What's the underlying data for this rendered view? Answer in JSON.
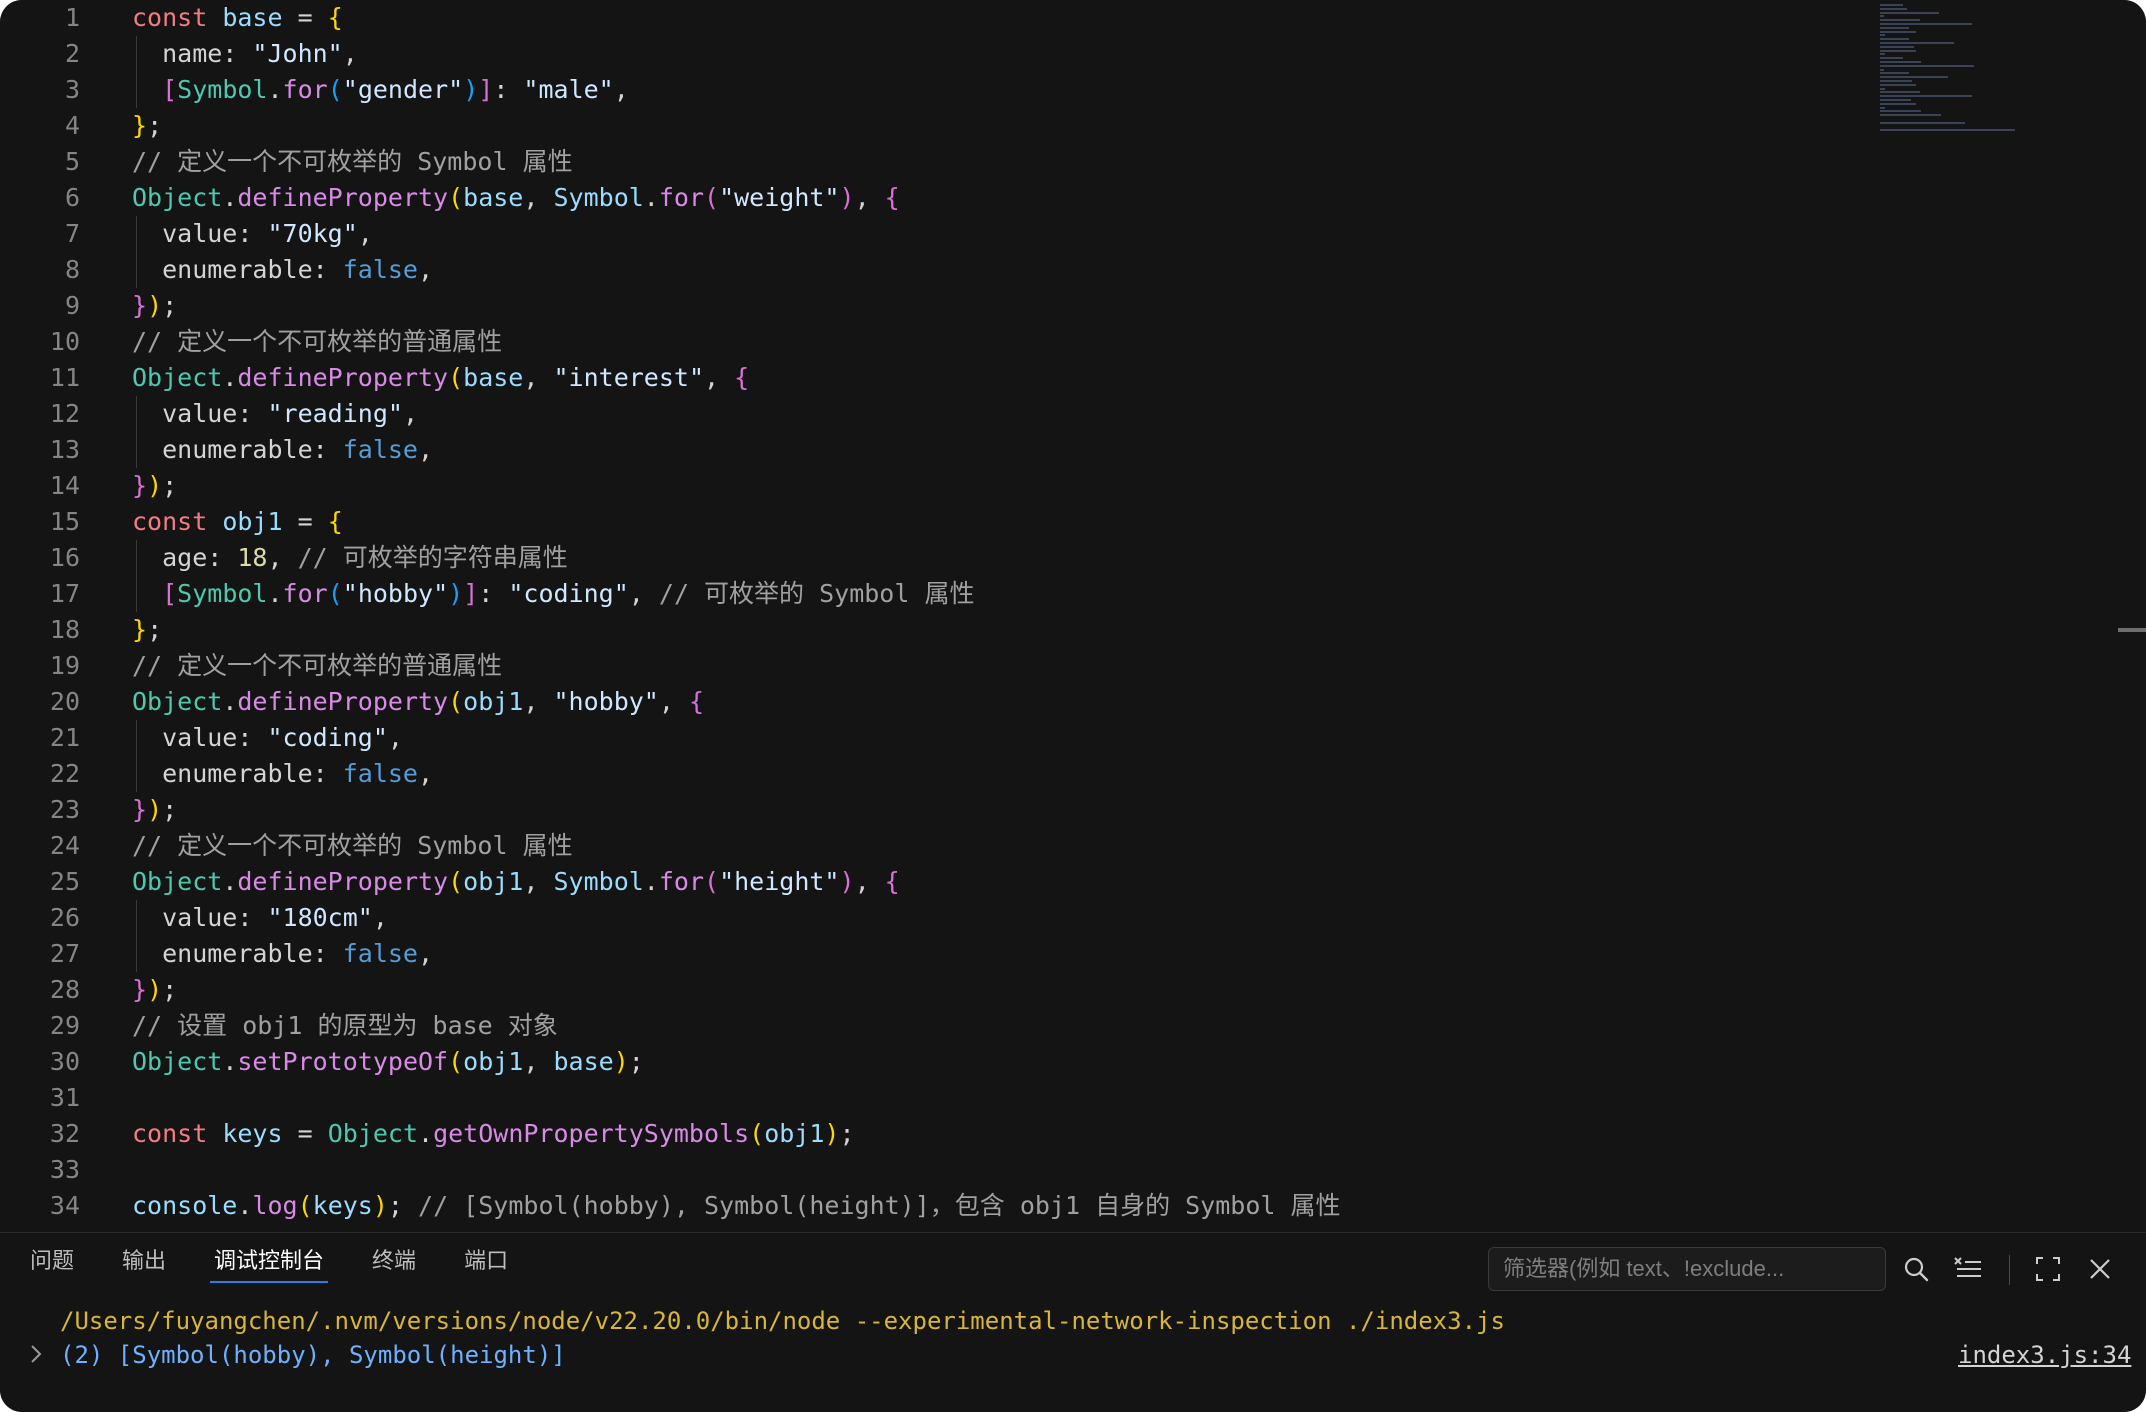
{
  "editor": {
    "lines": [
      {
        "n": "1",
        "t": [
          [
            "kw",
            "const "
          ],
          [
            "var",
            "base"
          ],
          [
            "",
            "="
          ],
          [
            "b1",
            " {"
          ]
        ]
      },
      {
        "n": "2",
        "g": true,
        "t": [
          [
            "",
            "  name: "
          ],
          [
            "str",
            "\"John\""
          ],
          [
            "",
            ","
          ]
        ]
      },
      {
        "n": "3",
        "g": true,
        "t": [
          [
            "",
            "  "
          ],
          [
            "b2",
            "["
          ],
          [
            "obj",
            "Symbol"
          ],
          [
            "",
            "."
          ],
          [
            "fn",
            "for"
          ],
          [
            "b3",
            "("
          ],
          [
            "str",
            "\"gender\""
          ],
          [
            "b3",
            ")"
          ],
          [
            "b2",
            "]"
          ],
          [
            "",
            ": "
          ],
          [
            "str",
            "\"male\""
          ],
          [
            "",
            ","
          ]
        ]
      },
      {
        "n": "4",
        "t": [
          [
            "b1",
            "}"
          ],
          [
            "",
            ";"
          ]
        ]
      },
      {
        "n": "5",
        "t": [
          [
            "cm",
            "// 定义一个不可枚举的 Symbol 属性"
          ]
        ]
      },
      {
        "n": "6",
        "t": [
          [
            "obj",
            "Object"
          ],
          [
            "",
            "."
          ],
          [
            "fn",
            "defineProperty"
          ],
          [
            "b1",
            "("
          ],
          [
            "var",
            "base"
          ],
          [
            "",
            ", "
          ],
          [
            "var",
            "Symbol"
          ],
          [
            "",
            "."
          ],
          [
            "fn",
            "for"
          ],
          [
            "b2",
            "("
          ],
          [
            "str",
            "\"weight\""
          ],
          [
            "b2",
            ")"
          ],
          [
            "",
            ", "
          ],
          [
            "b2",
            "{"
          ]
        ]
      },
      {
        "n": "7",
        "g": true,
        "t": [
          [
            "",
            "  value: "
          ],
          [
            "str",
            "\"70kg\""
          ],
          [
            "",
            ","
          ]
        ]
      },
      {
        "n": "8",
        "g": true,
        "t": [
          [
            "",
            "  enumerable: "
          ],
          [
            "bool",
            "false"
          ],
          [
            "",
            ","
          ]
        ]
      },
      {
        "n": "9",
        "t": [
          [
            "b2",
            "}"
          ],
          [
            "b1",
            ")"
          ],
          [
            "",
            ";"
          ]
        ]
      },
      {
        "n": "10",
        "t": [
          [
            "cm",
            "// 定义一个不可枚举的普通属性"
          ]
        ]
      },
      {
        "n": "11",
        "t": [
          [
            "obj",
            "Object"
          ],
          [
            "",
            "."
          ],
          [
            "fn",
            "defineProperty"
          ],
          [
            "b1",
            "("
          ],
          [
            "var",
            "base"
          ],
          [
            "",
            ", "
          ],
          [
            "str",
            "\"interest\""
          ],
          [
            "",
            ", "
          ],
          [
            "b2",
            "{"
          ]
        ]
      },
      {
        "n": "12",
        "g": true,
        "t": [
          [
            "",
            "  value: "
          ],
          [
            "str",
            "\"reading\""
          ],
          [
            "",
            ","
          ]
        ]
      },
      {
        "n": "13",
        "g": true,
        "t": [
          [
            "",
            "  enumerable: "
          ],
          [
            "bool",
            "false"
          ],
          [
            "",
            ","
          ]
        ]
      },
      {
        "n": "14",
        "t": [
          [
            "b2",
            "}"
          ],
          [
            "b1",
            ")"
          ],
          [
            "",
            ";"
          ]
        ]
      },
      {
        "n": "15",
        "t": [
          [
            "kw",
            "const "
          ],
          [
            "var",
            "obj1"
          ],
          [
            "",
            ""
          ],
          [
            "",
            "="
          ],
          [
            "b1",
            " {"
          ]
        ]
      },
      {
        "n": "16",
        "g": true,
        "t": [
          [
            "",
            "  age: "
          ],
          [
            "num",
            "18"
          ],
          [
            "",
            ", "
          ],
          [
            "cm",
            "// 可枚举的字符串属性"
          ]
        ]
      },
      {
        "n": "17",
        "g": true,
        "t": [
          [
            "",
            "  "
          ],
          [
            "b2",
            "["
          ],
          [
            "obj",
            "Symbol"
          ],
          [
            "",
            "."
          ],
          [
            "fn",
            "for"
          ],
          [
            "b3",
            "("
          ],
          [
            "str",
            "\"hobby\""
          ],
          [
            "b3",
            ")"
          ],
          [
            "b2",
            "]"
          ],
          [
            "",
            ": "
          ],
          [
            "str",
            "\"coding\""
          ],
          [
            "",
            ", "
          ],
          [
            "cm",
            "// 可枚举的 Symbol 属性"
          ]
        ]
      },
      {
        "n": "18",
        "t": [
          [
            "b1",
            "}"
          ],
          [
            "",
            ";"
          ]
        ]
      },
      {
        "n": "19",
        "t": [
          [
            "cm",
            "// 定义一个不可枚举的普通属性"
          ]
        ]
      },
      {
        "n": "20",
        "t": [
          [
            "obj",
            "Object"
          ],
          [
            "",
            "."
          ],
          [
            "fn",
            "defineProperty"
          ],
          [
            "b1",
            "("
          ],
          [
            "var",
            "obj1"
          ],
          [
            "",
            ", "
          ],
          [
            "str",
            "\"hobby\""
          ],
          [
            "",
            ", "
          ],
          [
            "b2",
            "{"
          ]
        ]
      },
      {
        "n": "21",
        "g": true,
        "t": [
          [
            "",
            "  value: "
          ],
          [
            "str",
            "\"coding\""
          ],
          [
            "",
            ","
          ]
        ]
      },
      {
        "n": "22",
        "g": true,
        "t": [
          [
            "",
            "  enumerable: "
          ],
          [
            "bool",
            "false"
          ],
          [
            "",
            ","
          ]
        ]
      },
      {
        "n": "23",
        "t": [
          [
            "b2",
            "}"
          ],
          [
            "b1",
            ")"
          ],
          [
            "",
            ";"
          ]
        ]
      },
      {
        "n": "24",
        "t": [
          [
            "cm",
            "// 定义一个不可枚举的 Symbol 属性"
          ]
        ]
      },
      {
        "n": "25",
        "t": [
          [
            "obj",
            "Object"
          ],
          [
            "",
            "."
          ],
          [
            "fn",
            "defineProperty"
          ],
          [
            "b1",
            "("
          ],
          [
            "var",
            "obj1"
          ],
          [
            "",
            ", "
          ],
          [
            "var",
            "Symbol"
          ],
          [
            "",
            "."
          ],
          [
            "fn",
            "for"
          ],
          [
            "b2",
            "("
          ],
          [
            "str",
            "\"height\""
          ],
          [
            "b2",
            ")"
          ],
          [
            "",
            ", "
          ],
          [
            "b2",
            "{"
          ]
        ]
      },
      {
        "n": "26",
        "g": true,
        "t": [
          [
            "",
            "  value: "
          ],
          [
            "str",
            "\"180cm\""
          ],
          [
            "",
            ","
          ]
        ]
      },
      {
        "n": "27",
        "g": true,
        "t": [
          [
            "",
            "  enumerable: "
          ],
          [
            "bool",
            "false"
          ],
          [
            "",
            ","
          ]
        ]
      },
      {
        "n": "28",
        "t": [
          [
            "b2",
            "}"
          ],
          [
            "b1",
            ")"
          ],
          [
            "",
            ";"
          ]
        ]
      },
      {
        "n": "29",
        "t": [
          [
            "cm",
            "// 设置 obj1 的原型为 base 对象"
          ]
        ]
      },
      {
        "n": "30",
        "t": [
          [
            "obj",
            "Object"
          ],
          [
            "",
            "."
          ],
          [
            "fn",
            "setPrototypeOf"
          ],
          [
            "b1",
            "("
          ],
          [
            "var",
            "obj1"
          ],
          [
            "",
            ", "
          ],
          [
            "var",
            "base"
          ],
          [
            "b1",
            ")"
          ],
          [
            "",
            ";"
          ]
        ]
      },
      {
        "n": "31",
        "t": []
      },
      {
        "n": "32",
        "t": [
          [
            "kw",
            "const "
          ],
          [
            "var",
            "keys"
          ],
          [
            "",
            ""
          ],
          [
            "",
            "= "
          ],
          [
            "obj",
            "Object"
          ],
          [
            "",
            "."
          ],
          [
            "fn",
            "getOwnPropertySymbols"
          ],
          [
            "b1",
            "("
          ],
          [
            "var",
            "obj1"
          ],
          [
            "b1",
            ")"
          ],
          [
            "",
            ";"
          ]
        ]
      },
      {
        "n": "33",
        "t": []
      },
      {
        "n": "34",
        "t": [
          [
            "var",
            "console"
          ],
          [
            "",
            "."
          ],
          [
            "fn",
            "log"
          ],
          [
            "b1",
            "("
          ],
          [
            "var",
            "keys"
          ],
          [
            "b1",
            ")"
          ],
          [
            "",
            "; "
          ],
          [
            "cm",
            "// [Symbol(hobby), Symbol(height)]，包含 obj1 自身的 Symbol 属性"
          ]
        ]
      }
    ]
  },
  "panel": {
    "tabs": [
      {
        "label": "问题",
        "active": false
      },
      {
        "label": "输出",
        "active": false
      },
      {
        "label": "调试控制台",
        "active": true
      },
      {
        "label": "终端",
        "active": false
      },
      {
        "label": "端口",
        "active": false
      }
    ],
    "filter_placeholder": "筛选器(例如 text、!exclude...",
    "console_command": "/Users/fuyangchen/.nvm/versions/node/v22.20.0/bin/node --experimental-network-inspection ./index3.js",
    "console_output": "(2) [Symbol(hobby), Symbol(height)]",
    "source_ref": "index3.js:34"
  },
  "colors": {
    "background": "#141414",
    "keyword": "#f47c84",
    "variable": "#9cdcfe",
    "function": "#d88ae6",
    "object": "#4ec9b0",
    "comment": "#a0a0a0",
    "path": "#d7b63a",
    "output": "#6fb1ff",
    "active_tab_underline": "#2d7ee0"
  },
  "icons": [
    "search-icon",
    "clear-console-icon",
    "maximize-panel-icon",
    "close-panel-icon",
    "expand-chevron-icon"
  ]
}
